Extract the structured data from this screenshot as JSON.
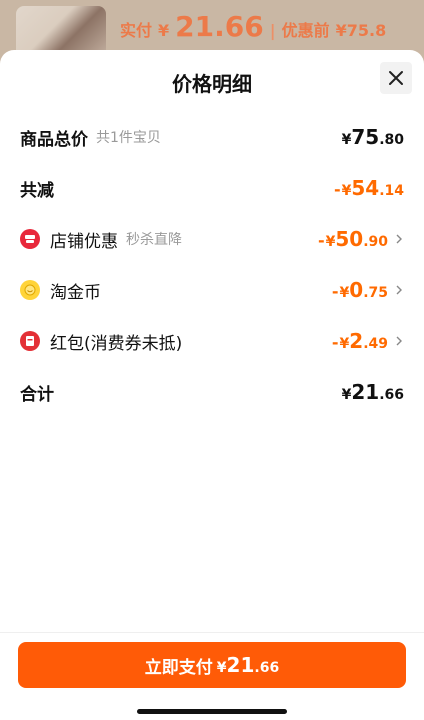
{
  "background": {
    "paid_label": "实付",
    "paid_currency": "¥",
    "paid_amount": "21.66",
    "separator": "|",
    "before_label": "优惠前",
    "before_amount": "¥75.8"
  },
  "sheet": {
    "title": "价格明细",
    "close_icon": "close-icon"
  },
  "rows": {
    "total": {
      "label": "商品总价",
      "sub": "共1件宝贝",
      "sym": "¥",
      "int": "75",
      "dec": ".80"
    },
    "reduce": {
      "label": "共减",
      "minus": "-",
      "sym": "¥",
      "int": "54",
      "dec": ".14"
    },
    "shop": {
      "label": "店铺优惠",
      "sub": "秒杀直降",
      "minus": "-",
      "sym": "¥",
      "int": "50",
      "dec": ".90",
      "icon": "shop-icon"
    },
    "coin": {
      "label": "淘金币",
      "minus": "-",
      "sym": "¥",
      "int": "0",
      "dec": ".75",
      "icon": "coin-icon"
    },
    "redpacket": {
      "label": "红包(消费券未抵)",
      "minus": "-",
      "sym": "¥",
      "int": "2",
      "dec": ".49",
      "icon": "red-packet-icon"
    },
    "sum": {
      "label": "合计",
      "sym": "¥",
      "int": "21",
      "dec": ".66"
    }
  },
  "pay_button": {
    "label": "立即支付",
    "sym": "¥",
    "int": "21",
    "dec": ".66"
  },
  "colors": {
    "accent": "#ff5b07",
    "discount": "#ff6a00"
  }
}
